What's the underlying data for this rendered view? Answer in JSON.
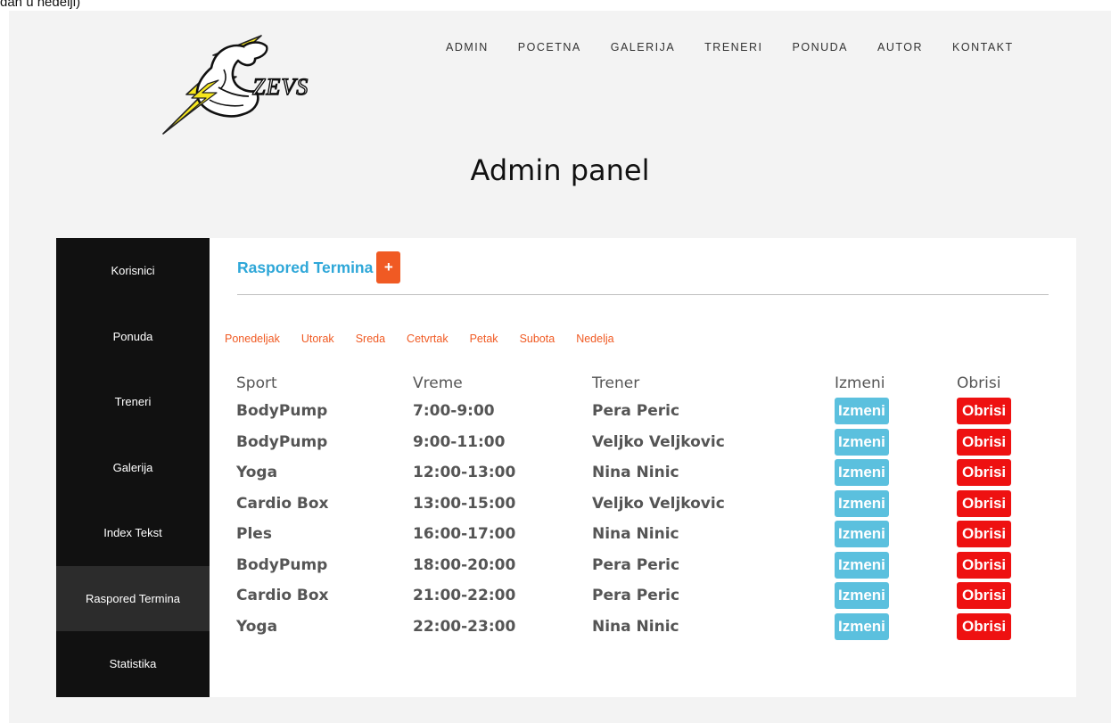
{
  "top_note": "dan u nedelji)",
  "logo": {
    "text": "ZEVS"
  },
  "nav": [
    "ADMIN",
    "POCETNA",
    "GALERIJA",
    "TRENERI",
    "PONUDA",
    "AUTOR",
    "KONTAKT"
  ],
  "page_title": "Admin panel",
  "sidebar": [
    {
      "label": "Korisnici",
      "active": false
    },
    {
      "label": "Ponuda",
      "active": false
    },
    {
      "label": "Treneri",
      "active": false
    },
    {
      "label": "Galerija",
      "active": false
    },
    {
      "label": "Index Tekst",
      "active": false
    },
    {
      "label": "Raspored Termina",
      "active": true
    },
    {
      "label": "Statistika",
      "active": false
    }
  ],
  "section": {
    "title": "Raspored Termina",
    "add_label": "+"
  },
  "days": [
    "Ponedeljak",
    "Utorak",
    "Sreda",
    "Cetvrtak",
    "Petak",
    "Subota",
    "Nedelja"
  ],
  "table": {
    "headers": [
      "Sport",
      "Vreme",
      "Trener",
      "Izmeni",
      "Obrisi"
    ],
    "rows": [
      [
        "BodyPump",
        "7:00-9:00",
        "Pera Peric"
      ],
      [
        "BodyPump",
        "9:00-11:00",
        "Veljko Veljkovic"
      ],
      [
        "Yoga",
        "12:00-13:00",
        "Nina Ninic"
      ],
      [
        "Cardio Box",
        "13:00-15:00",
        "Veljko Veljkovic"
      ],
      [
        "Ples",
        "16:00-17:00",
        "Nina Ninic"
      ],
      [
        "BodyPump",
        "18:00-20:00",
        "Pera Peric"
      ],
      [
        "Cardio Box",
        "21:00-22:00",
        "Pera Peric"
      ],
      [
        "Yoga",
        "22:00-23:00",
        "Nina Ninic"
      ]
    ],
    "edit_label": "Izmeni",
    "delete_label": "Obrisi"
  },
  "colors": {
    "accent_blue": "#2ea7d8",
    "accent_orange": "#f05a23",
    "edit_button": "#5bc0de",
    "delete_button": "#ee1111",
    "sidebar_bg": "#111111",
    "sidebar_active": "#2c2c2c",
    "page_bg": "#f3f3f3"
  }
}
